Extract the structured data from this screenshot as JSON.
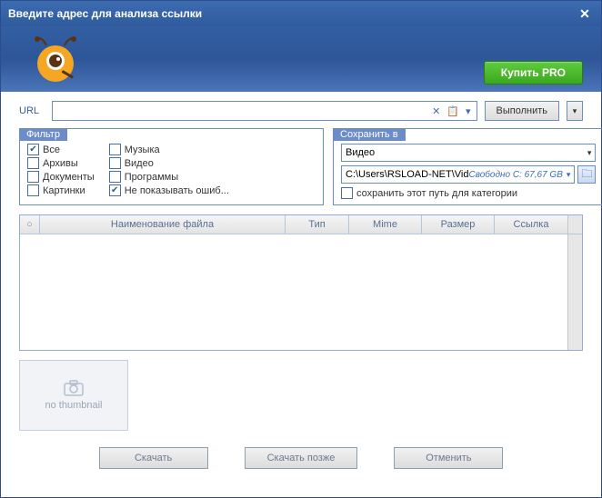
{
  "window": {
    "title": "Введите адрес для анализа ссылки"
  },
  "header": {
    "buy_label": "Купить PRO"
  },
  "url": {
    "label": "URL",
    "value": "",
    "execute_label": "Выполнить"
  },
  "filter": {
    "legend": "Фильтр",
    "col1": [
      {
        "label": "Все",
        "checked": true
      },
      {
        "label": "Архивы",
        "checked": false
      },
      {
        "label": "Документы",
        "checked": false
      },
      {
        "label": "Картинки",
        "checked": false
      }
    ],
    "col2": [
      {
        "label": "Музыка",
        "checked": false
      },
      {
        "label": "Видео",
        "checked": false
      },
      {
        "label": "Программы",
        "checked": false
      },
      {
        "label": "Не показывать ошиб...",
        "checked": true
      }
    ]
  },
  "save": {
    "legend": "Сохранить в",
    "category": "Видео",
    "path": "C:\\Users\\RSLOAD-NET\\Vid",
    "free_space": "Свободно C: 67,67 GB",
    "remember_label": "сохранить этот путь для категории",
    "remember_checked": false
  },
  "table": {
    "cols": {
      "c0": "○",
      "c1": "Наименование файла",
      "c2": "Тип",
      "c3": "Mime",
      "c4": "Размер",
      "c5": "Ссылка"
    }
  },
  "thumbnail": {
    "label": "no thumbnail"
  },
  "buttons": {
    "download": "Скачать",
    "later": "Скачать позже",
    "cancel": "Отменить"
  }
}
